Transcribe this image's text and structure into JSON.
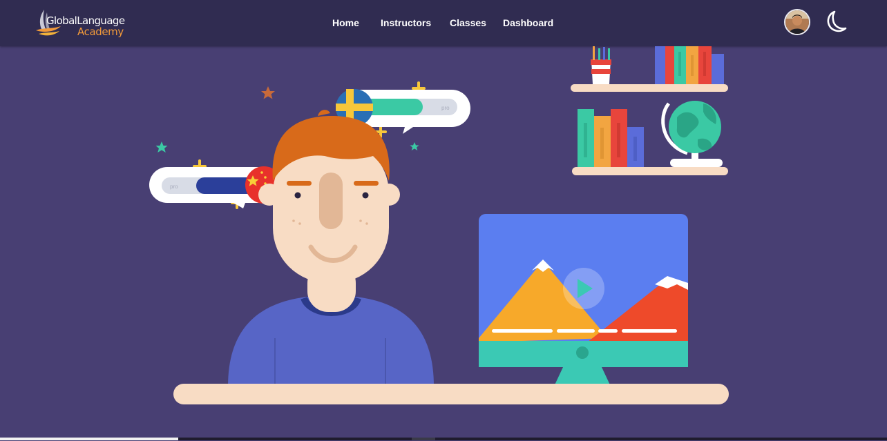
{
  "brand": {
    "line1": "GlobalLanguage",
    "line2": "Academy",
    "accent_color": "#f29a3a"
  },
  "nav": {
    "items": [
      {
        "label": "Home"
      },
      {
        "label": "Instructors"
      },
      {
        "label": "Classes"
      },
      {
        "label": "Dashboard"
      }
    ]
  },
  "user": {
    "avatar_icon": "user-avatar"
  },
  "theme_toggle": {
    "icon": "moon-icon"
  },
  "hero": {
    "illustration": "language-learning-illustration",
    "bubble_tag_left": "pro",
    "bubble_tag_right": "pro"
  },
  "colors": {
    "navbar": "#302c51",
    "background": "#483f73"
  }
}
